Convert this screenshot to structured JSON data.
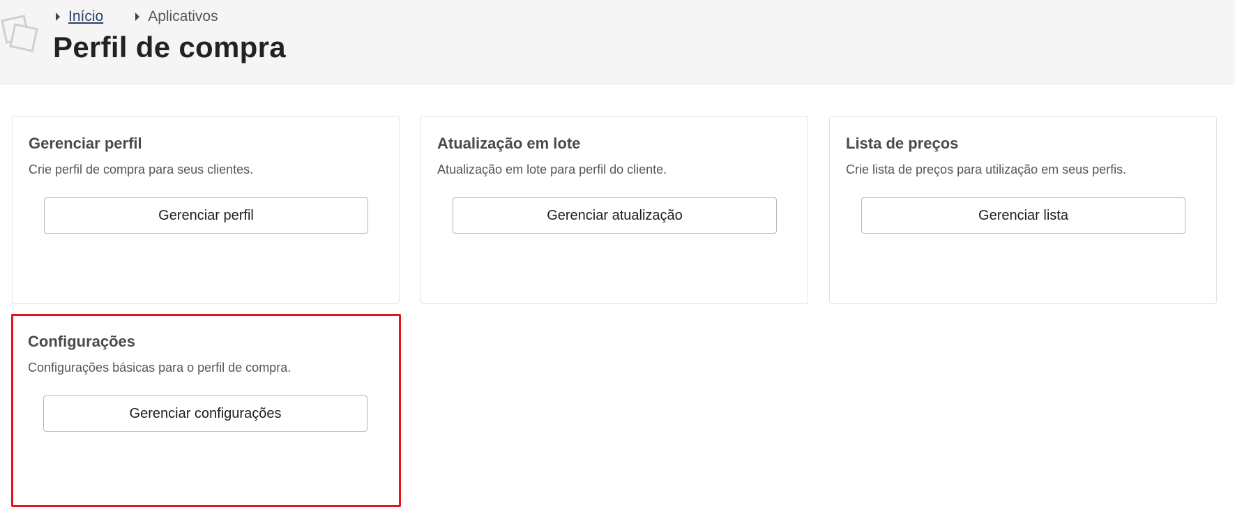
{
  "breadcrumb": {
    "home_label": "Início",
    "apps_label": "Aplicativos"
  },
  "page": {
    "title": "Perfil de compra"
  },
  "cards": [
    {
      "title": "Gerenciar perfil",
      "description": "Crie perfil de compra para seus clientes.",
      "button_label": "Gerenciar perfil"
    },
    {
      "title": "Atualização em lote",
      "description": "Atualização em lote para perfil do cliente.",
      "button_label": "Gerenciar atualização"
    },
    {
      "title": "Lista de preços",
      "description": "Crie lista de preços para utilização em seus perfis.",
      "button_label": "Gerenciar lista"
    },
    {
      "title": "Configurações",
      "description": "Configurações básicas para o perfil de compra.",
      "button_label": "Gerenciar configurações",
      "highlighted": true
    }
  ],
  "colors": {
    "highlight_border": "#e5141b",
    "header_background": "#f5f5f5",
    "link": "#2a3f6b"
  }
}
